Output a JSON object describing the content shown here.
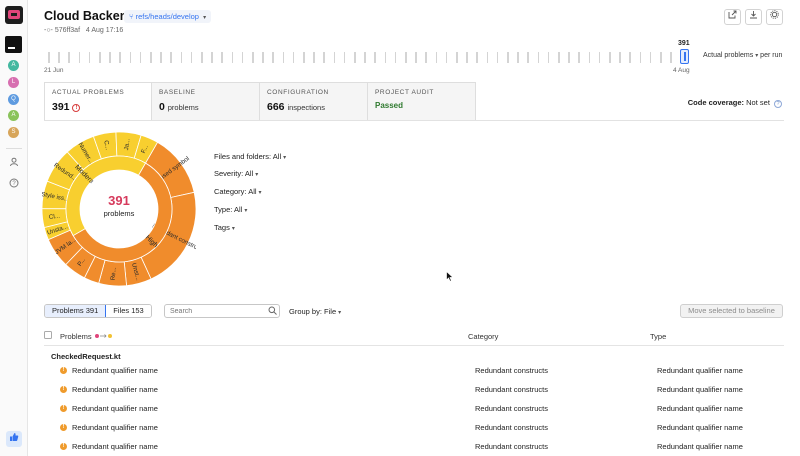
{
  "header": {
    "title": "Cloud Backend",
    "branch": "refs/heads/develop",
    "commit": "576ff3af",
    "date": "4 Aug 17:16"
  },
  "timeline": {
    "start_label": "21 Jun",
    "end_label": "4 Aug",
    "current_value": "391",
    "metric": "Actual problems",
    "per_label": "per run"
  },
  "rail": {
    "avatars": [
      {
        "letter": "A",
        "color": "#43b8a0"
      },
      {
        "letter": "L",
        "color": "#d76fb0"
      },
      {
        "letter": "Q",
        "color": "#5e9be0"
      },
      {
        "letter": "A",
        "color": "#8ac35b"
      },
      {
        "letter": "S",
        "color": "#d7a55a"
      }
    ]
  },
  "summary_tabs": [
    {
      "caption": "ACTUAL PROBLEMS",
      "value": "391",
      "unit": ""
    },
    {
      "caption": "BASELINE",
      "value": "0",
      "unit": "problems"
    },
    {
      "caption": "CONFIGURATION",
      "value": "666",
      "unit": "inspections"
    },
    {
      "caption": "PROJECT AUDIT",
      "value": "Passed",
      "unit": ""
    }
  ],
  "coverage": {
    "label": "Code coverage:",
    "value": "Not set"
  },
  "sunburst": {
    "count": "391",
    "label": "problems",
    "colors": {
      "high": "#f08c2c",
      "moderate": "#f8cf2f"
    },
    "inner": [
      {
        "label": "High",
        "level": "high",
        "value": 228
      },
      {
        "label": "Moderate",
        "level": "moderate",
        "value": 163
      }
    ],
    "outer": [
      {
        "label": "Unused symbol",
        "level": "high",
        "value": 50
      },
      {
        "label": "Redundant constructs",
        "level": "high",
        "value": 82
      },
      {
        "label": "Unst...",
        "level": "high",
        "value": 20
      },
      {
        "label": "Re...",
        "level": "high",
        "value": 22
      },
      {
        "label": "",
        "level": "high",
        "value": 12
      },
      {
        "label": "P...",
        "level": "high",
        "value": 18
      },
      {
        "label": "JVM la...",
        "level": "high",
        "value": 24
      },
      {
        "label": "Unsta...",
        "level": "moderate",
        "value": 10
      },
      {
        "label": "Cl...",
        "level": "moderate",
        "value": 15
      },
      {
        "label": "Style iss...",
        "level": "moderate",
        "value": 22
      },
      {
        "label": "Redund...",
        "level": "moderate",
        "value": 28
      },
      {
        "label": "Numer...",
        "level": "moderate",
        "value": 24
      },
      {
        "label": "C...",
        "level": "moderate",
        "value": 18
      },
      {
        "label": "Ja...",
        "level": "moderate",
        "value": 20
      },
      {
        "label": "F...",
        "level": "moderate",
        "value": 14
      }
    ]
  },
  "filters": [
    {
      "label": "Files and folders:",
      "value": "All"
    },
    {
      "label": "Severity:",
      "value": "All"
    },
    {
      "label": "Category:",
      "value": "All"
    },
    {
      "label": "Type:",
      "value": "All"
    },
    {
      "label": "Tags",
      "value": ""
    }
  ],
  "toolbar": {
    "problems_tab": "Problems 391",
    "files_tab": "Files 153",
    "search_placeholder": "Search",
    "group_by_label": "Group by:",
    "group_by_value": "File",
    "move_button": "Move selected to baseline"
  },
  "table": {
    "columns": [
      "Problems",
      "Category",
      "Type"
    ],
    "group": "CheckedRequest.kt",
    "rows": [
      {
        "problem": "Redundant qualifier name",
        "category": "Redundant constructs",
        "type": "Redundant qualifier name"
      },
      {
        "problem": "Redundant qualifier name",
        "category": "Redundant constructs",
        "type": "Redundant qualifier name"
      },
      {
        "problem": "Redundant qualifier name",
        "category": "Redundant constructs",
        "type": "Redundant qualifier name"
      },
      {
        "problem": "Redundant qualifier name",
        "category": "Redundant constructs",
        "type": "Redundant qualifier name"
      },
      {
        "problem": "Redundant qualifier name",
        "category": "Redundant constructs",
        "type": "Redundant qualifier name"
      }
    ]
  }
}
